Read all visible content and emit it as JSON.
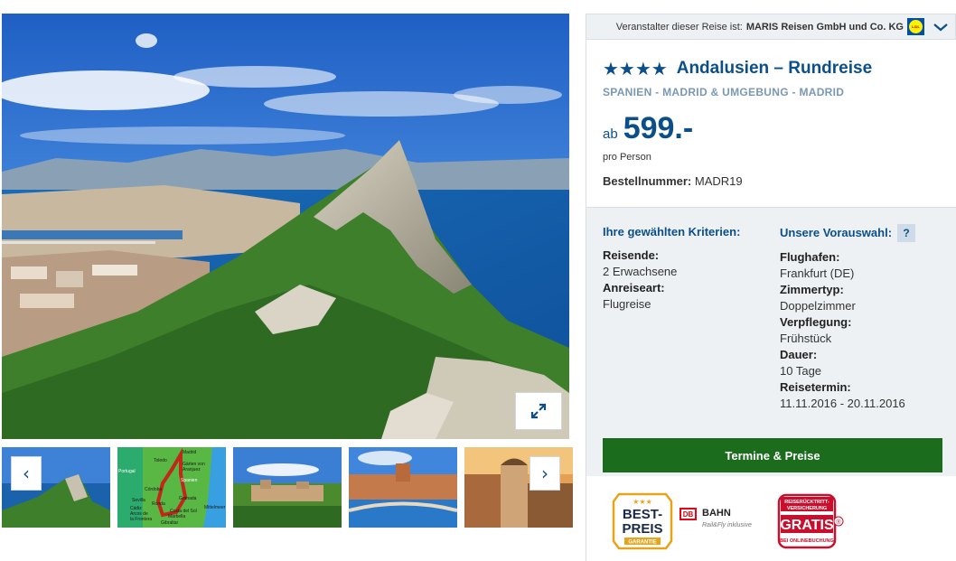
{
  "organizer": {
    "label": "Veranstalter dieser Reise ist:",
    "name": "MARIS Reisen GmbH und Co. KG",
    "logo_text": "LiDL"
  },
  "offer": {
    "stars": "★★★★",
    "title": "Andalusien – Rundreise",
    "location": "SPANIEN - MADRID & UMGEBUNG - MADRID",
    "price_prefix": "ab",
    "price": "599.-",
    "per_person": "pro Person",
    "order_label": "Bestellnummer:",
    "order_number": "MADR19"
  },
  "criteria": {
    "title": "Ihre gewählten Kriterien:",
    "items": [
      {
        "label": "Reisende:",
        "value": "2 Erwachsene"
      },
      {
        "label": "Anreiseart:",
        "value": "Flugreise"
      }
    ]
  },
  "preselection": {
    "title": "Unsere Vorauswahl:",
    "help": "?",
    "items": [
      {
        "label": "Flughafen:",
        "value": "Frankfurt (DE)"
      },
      {
        "label": "Zimmertyp:",
        "value": "Doppelzimmer"
      },
      {
        "label": "Verpflegung:",
        "value": "Frühstück"
      },
      {
        "label": "Dauer:",
        "value": "10 Tage"
      },
      {
        "label": "Reisetermin:",
        "value": "11.11.2016 - 20.11.2016"
      }
    ]
  },
  "cta": {
    "label": "Termine & Preise"
  },
  "gallery": {
    "prev": "‹",
    "next": "›",
    "map_labels": [
      "Madrid",
      "Toledo",
      "Gärten von",
      "Aranjuez",
      "Portugal",
      "Spanien",
      "Córdoba",
      "Sevilla",
      "Granada",
      "Ronda",
      "Cádiz",
      "Arcos de",
      "la Frontera",
      "Costa del Sol",
      "Marbella",
      "Gibraltar",
      "Mittelmeer"
    ]
  },
  "badges": {
    "bestpreis": {
      "line1": "BEST-",
      "line2": "PREIS",
      "sub": "GARANTIE",
      "stars": "★★★"
    },
    "db": {
      "logo": "DB",
      "name": "BAHN",
      "sub": "Rail&Fly inklusive"
    },
    "gratis": {
      "line1": "REISERÜCKTRITT-",
      "line2": "VERSICHERUNG",
      "main": "GRATIS",
      "sub": "BEI ONLINEBUCHUNG",
      "mark": "®"
    }
  },
  "colors": {
    "brand_blue": "#0b4f8a",
    "cta_green": "#1c6c1e",
    "panel_bg": "#eef1f4"
  }
}
